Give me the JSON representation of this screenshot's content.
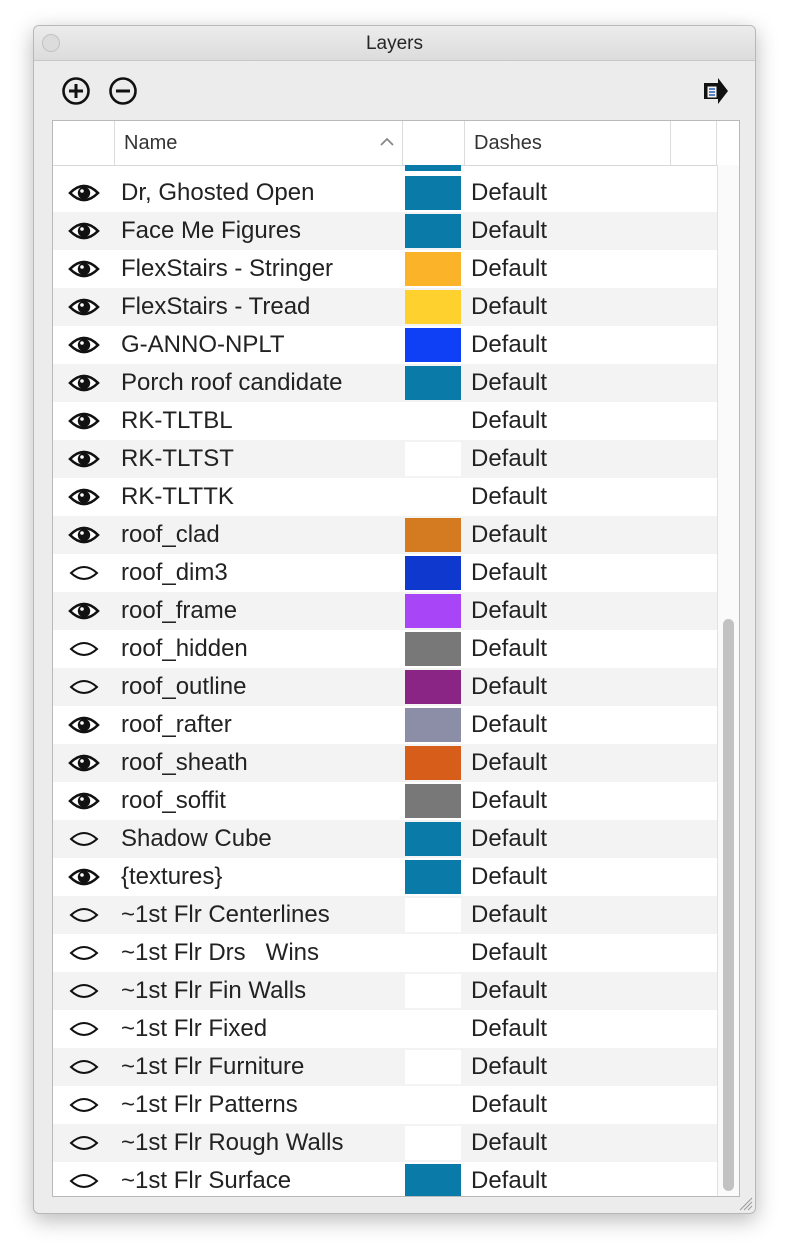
{
  "window": {
    "title": "Layers"
  },
  "toolbar": {
    "add_icon": "plus-circle-icon",
    "remove_icon": "minus-circle-icon",
    "export_icon": "export-arrow-icon"
  },
  "columns": {
    "visibility": "",
    "name": "Name",
    "color": "",
    "dashes": "Dashes"
  },
  "sort": {
    "column": "Name",
    "direction": "ascending"
  },
  "layers": [
    {
      "name": "Dr, Ghosted Open",
      "visible": true,
      "color": "#0a7aa8",
      "dashes": "Default"
    },
    {
      "name": "Face Me Figures",
      "visible": true,
      "color": "#0a7aa8",
      "dashes": "Default"
    },
    {
      "name": "FlexStairs - Stringer",
      "visible": true,
      "color": "#fbb42a",
      "dashes": "Default"
    },
    {
      "name": "FlexStairs - Tread",
      "visible": true,
      "color": "#fed12f",
      "dashes": "Default"
    },
    {
      "name": "G-ANNO-NPLT",
      "visible": true,
      "color": "#1040f6",
      "dashes": "Default"
    },
    {
      "name": "Porch roof candidate",
      "visible": true,
      "color": "#0a7aa8",
      "dashes": "Default"
    },
    {
      "name": "RK-TLTBL",
      "visible": true,
      "color": "",
      "dashes": "Default"
    },
    {
      "name": "RK-TLTST",
      "visible": true,
      "color": "#ffffff",
      "dashes": "Default"
    },
    {
      "name": "RK-TLTTK",
      "visible": true,
      "color": "",
      "dashes": "Default"
    },
    {
      "name": "roof_clad",
      "visible": true,
      "color": "#d47a20",
      "dashes": "Default"
    },
    {
      "name": "roof_dim3",
      "visible": false,
      "color": "#0f38cf",
      "dashes": "Default"
    },
    {
      "name": "roof_frame",
      "visible": true,
      "color": "#a845f7",
      "dashes": "Default"
    },
    {
      "name": "roof_hidden",
      "visible": false,
      "color": "#787878",
      "dashes": "Default"
    },
    {
      "name": "roof_outline",
      "visible": false,
      "color": "#8a2585",
      "dashes": "Default"
    },
    {
      "name": "roof_rafter",
      "visible": true,
      "color": "#8c8ea8",
      "dashes": "Default"
    },
    {
      "name": "roof_sheath",
      "visible": true,
      "color": "#d65e1a",
      "dashes": "Default"
    },
    {
      "name": "roof_soffit",
      "visible": true,
      "color": "#787878",
      "dashes": "Default"
    },
    {
      "name": "Shadow Cube",
      "visible": false,
      "color": "#0a7aa8",
      "dashes": "Default"
    },
    {
      "name": "{textures}",
      "visible": true,
      "color": "#0a7aa8",
      "dashes": "Default"
    },
    {
      "name": "~1st Flr Centerlines",
      "visible": false,
      "color": "#ffffff",
      "dashes": "Default"
    },
    {
      "name": "~1st Flr Drs   Wins",
      "visible": false,
      "color": "",
      "dashes": "Default"
    },
    {
      "name": "~1st Flr Fin Walls",
      "visible": false,
      "color": "#ffffff",
      "dashes": "Default"
    },
    {
      "name": "~1st Flr Fixed",
      "visible": false,
      "color": "",
      "dashes": "Default"
    },
    {
      "name": "~1st Flr Furniture",
      "visible": false,
      "color": "#ffffff",
      "dashes": "Default"
    },
    {
      "name": "~1st Flr Patterns",
      "visible": false,
      "color": "",
      "dashes": "Default"
    },
    {
      "name": "~1st Flr Rough Walls",
      "visible": false,
      "color": "#ffffff",
      "dashes": "Default"
    },
    {
      "name": "~1st Flr Surface",
      "visible": false,
      "color": "#0a7aa8",
      "dashes": "Default"
    }
  ]
}
